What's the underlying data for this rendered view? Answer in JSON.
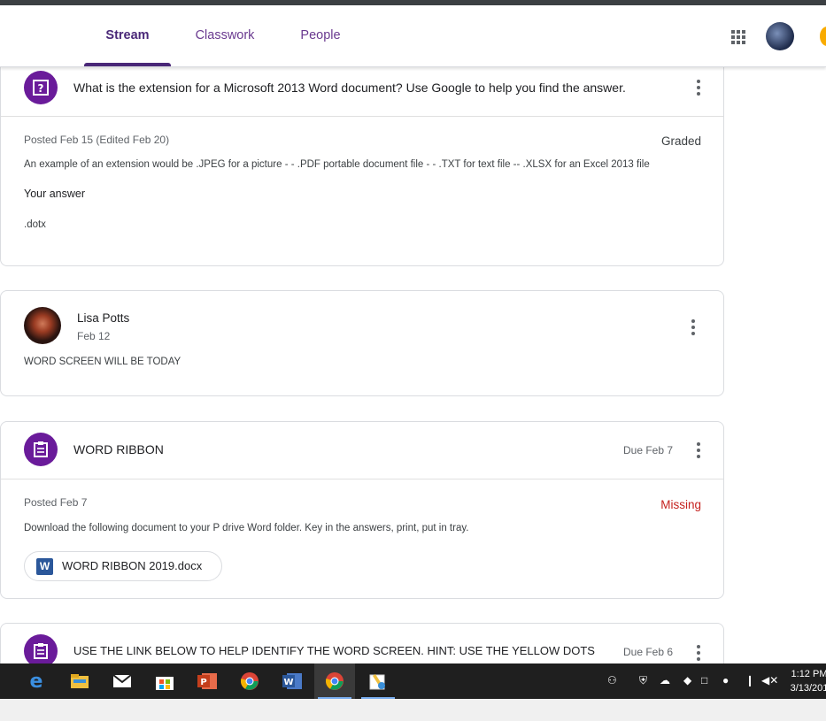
{
  "header": {
    "tabs": [
      {
        "label": "Stream",
        "active": true
      },
      {
        "label": "Classwork",
        "active": false
      },
      {
        "label": "People",
        "active": false
      }
    ],
    "apps_icon": "apps-grid-icon",
    "avatar": "user-avatar"
  },
  "question_card": {
    "icon": "question-assignment-icon",
    "title": "What is the extension for a Microsoft 2013 Word document? Use Google to help you find the answer.",
    "posted": "Posted Feb 15 (Edited Feb 20)",
    "status": "Graded",
    "description": "An example of an extension would be .JPEG for a picture - - .PDF portable document file - - .TXT for text file -- .XLSX for an Excel 2013 file",
    "answer_label": "Your answer",
    "answer_value": ".dotx"
  },
  "announcement_card": {
    "author": "Lisa Potts",
    "date": "Feb 12",
    "text": "WORD SCREEN WILL BE TODAY"
  },
  "ribbon_card": {
    "icon": "assignment-icon",
    "title": "WORD RIBBON",
    "due": "Due Feb 7",
    "posted": "Posted Feb 7",
    "status": "Missing",
    "description": "Download the following document to your P drive Word folder. Key in the answers, print, put in tray.",
    "attachment": "WORD RIBBON 2019.docx",
    "attachment_icon": "W"
  },
  "screen_card": {
    "icon": "assignment-icon",
    "title": "USE THE LINK BELOW TO HELP IDENTIFY THE WORD SCREEN. HINT: USE THE YELLOW DOTS",
    "due": "Due Feb 6"
  },
  "taskbar": {
    "time": "1:12 PM",
    "date": "3/13/201",
    "apps": [
      "edge-icon",
      "file-explorer-icon",
      "mail-icon",
      "store-icon",
      "powerpoint-icon",
      "chrome-icon",
      "word-icon",
      "chrome-icon",
      "paint-icon"
    ]
  },
  "colors": {
    "purple_accent": "#6a1b9a",
    "missing_red": "#c5221f",
    "word_blue": "#2b579a"
  }
}
